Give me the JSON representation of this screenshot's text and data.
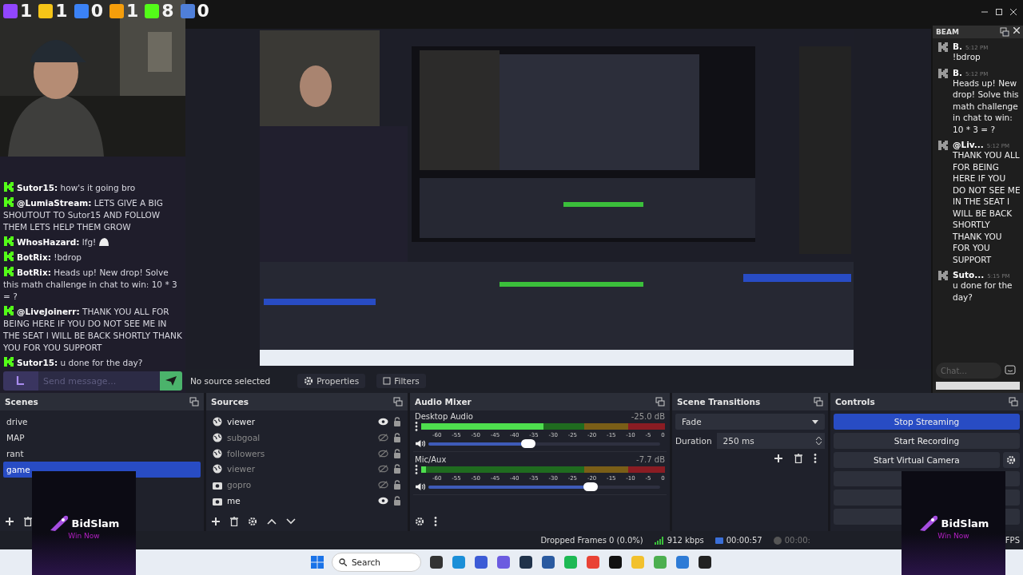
{
  "stream_stats": [
    {
      "color": "#9146ff",
      "count": "1"
    },
    {
      "color": "#f5c518",
      "count": "1"
    },
    {
      "color": "#3b82f6",
      "count": "0"
    },
    {
      "color": "#f59e0b",
      "count": "1"
    },
    {
      "color": "#53fc18",
      "count": "8"
    },
    {
      "color": "#4f7fd9",
      "count": "0"
    }
  ],
  "chat": {
    "messages": [
      {
        "user": "Sutor15:",
        "text": "how's it going bro",
        "emote": false
      },
      {
        "user": "@LumiaStream:",
        "text": "LETS GIVE A BIG SHOUTOUT TO Sutor15 AND FOLLOW THEM LETS HELP THEM GROW",
        "emote": false
      },
      {
        "user": "WhosHazard:",
        "text": "lfg!",
        "emote": true
      },
      {
        "user": "BotRix:",
        "text": "!bdrop",
        "emote": false
      },
      {
        "user": "BotRix:",
        "text": "Heads up! New drop! Solve this math challenge in chat to win: 10 * 3 = ?",
        "emote": false
      },
      {
        "user": "@LiveJoinerr:",
        "text": "THANK YOU ALL FOR BEING HERE IF YOU DO NOT SEE ME IN THE SEAT I WILL BE BACK SHORTLY THANK YOU FOR YOU SUPPORT",
        "emote": false
      },
      {
        "user": "Sutor15:",
        "text": "u done for the day?",
        "emote": false
      }
    ],
    "placeholder": "Send message..."
  },
  "toolbar": {
    "status": "No source selected",
    "buttons": [
      "Properties",
      "Filters"
    ]
  },
  "beam": {
    "title": "BEAM",
    "messages": [
      {
        "user": "B.",
        "time": "5:12 PM",
        "text": "!bdrop"
      },
      {
        "user": "B.",
        "time": "5:12 PM",
        "text": "Heads up! New drop! Solve this math challenge in chat to win: 10 * 3 = ?"
      },
      {
        "user": "@Liv...",
        "time": "5:12 PM",
        "text": "THANK YOU ALL FOR BEING HERE IF YOU DO NOT SEE ME IN THE SEAT I WILL BE BACK SHORTLY THANK YOU FOR YOU SUPPORT"
      },
      {
        "user": "Suto...",
        "time": "5:15 PM",
        "text": "u done for the day?"
      }
    ],
    "placeholder": "Chat..."
  },
  "scenes": {
    "title": "Scenes",
    "items": [
      {
        "name": "drive",
        "selected": false
      },
      {
        "name": "MAP",
        "selected": false
      },
      {
        "name": "rant",
        "selected": false
      },
      {
        "name": "game",
        "selected": true
      }
    ]
  },
  "sources": {
    "title": "Sources",
    "items": [
      {
        "name": "viewer",
        "kind": "browser",
        "visible": true
      },
      {
        "name": "subgoal",
        "kind": "browser",
        "visible": false
      },
      {
        "name": "followers",
        "kind": "browser",
        "visible": false
      },
      {
        "name": "viewer",
        "kind": "browser",
        "visible": false
      },
      {
        "name": "gopro",
        "kind": "camera",
        "visible": false
      },
      {
        "name": "me",
        "kind": "camera",
        "visible": true
      }
    ]
  },
  "audio_mixer": {
    "title": "Audio Mixer",
    "channels": [
      {
        "name": "Desktop Audio",
        "reading": "-25.0 dB",
        "meter": {
          "level": 0.5
        },
        "level": 0.43,
        "scale": [
          "-60",
          "-55",
          "-50",
          "-45",
          "-40",
          "-35",
          "-30",
          "-25",
          "-20",
          "-15",
          "-10",
          "-5",
          "0"
        ]
      },
      {
        "name": "Mic/Aux",
        "reading": "-7.7 dB",
        "meter": {
          "level": 0.02
        },
        "level": 0.7,
        "scale": [
          "-60",
          "-55",
          "-50",
          "-45",
          "-40",
          "-35",
          "-30",
          "-25",
          "-20",
          "-15",
          "-10",
          "-5",
          "0"
        ]
      }
    ]
  },
  "scene_transitions": {
    "title": "Scene Transitions",
    "transition": "Fade",
    "duration_label": "Duration",
    "duration": "250 ms"
  },
  "controls": {
    "title": "Controls",
    "buttons": [
      {
        "label": "Stop Streaming",
        "selected": true
      },
      {
        "label": "Start Recording",
        "selected": false
      },
      {
        "label": "Start Virtual Camera",
        "selected": false
      }
    ]
  },
  "status_bar": {
    "dropped": "Dropped Frames 0 (0.0%)",
    "bitrate": "912 kbps",
    "stream_time": "00:00:57",
    "record_time": "00:00:",
    "fps": "FPS"
  },
  "ads": [
    {
      "title": "BidSlam",
      "subtitle": "Win Now"
    },
    {
      "title": "BidSlam",
      "subtitle": "Win Now"
    }
  ],
  "taskbar": {
    "search": "Search"
  }
}
